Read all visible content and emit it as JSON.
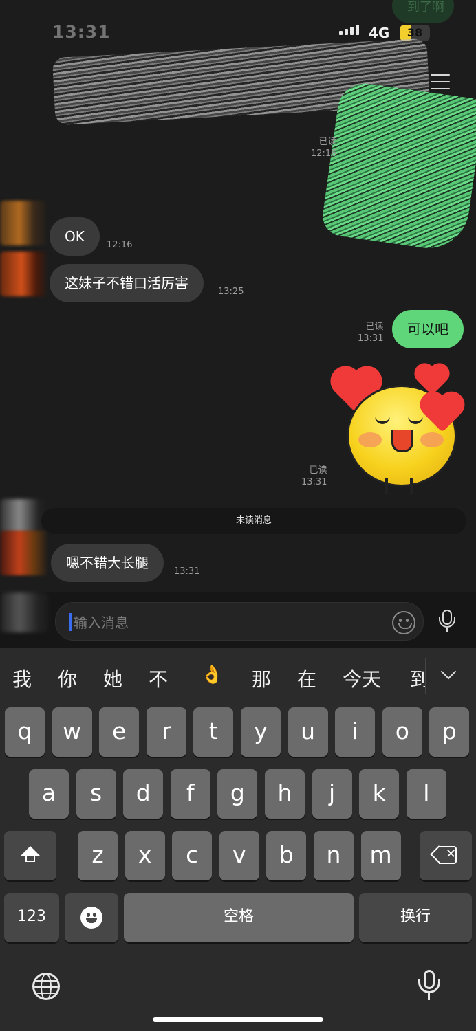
{
  "status_bar": {
    "time": "13:31",
    "network": "4G",
    "battery": "38",
    "battery_level": 0.38
  },
  "header": {
    "partial_bubble_text": "到了啊"
  },
  "messages": [
    {
      "id": "read-1",
      "read_label": "已读",
      "time": "12:16"
    },
    {
      "id": "in-1",
      "text": "OK",
      "time": "12:16"
    },
    {
      "id": "in-2",
      "text": "这妹子不错口活厉害",
      "time": "13:25"
    },
    {
      "id": "out-1",
      "text": "可以吧",
      "read_label": "已读",
      "time": "13:31"
    },
    {
      "id": "sticker",
      "read_label": "已读",
      "time": "13:31"
    },
    {
      "id": "in-3",
      "text": "嗯不错大长腿",
      "time": "13:31"
    }
  ],
  "unread_divider": "未读消息",
  "input": {
    "placeholder": "输入消息"
  },
  "keyboard": {
    "candidates": [
      "我",
      "你",
      "她",
      "不",
      "👌",
      "那",
      "在",
      "今天",
      "到"
    ],
    "row1": [
      "q",
      "w",
      "e",
      "r",
      "t",
      "y",
      "u",
      "i",
      "o",
      "p"
    ],
    "row2": [
      "a",
      "s",
      "d",
      "f",
      "g",
      "h",
      "j",
      "k",
      "l"
    ],
    "row3": [
      "z",
      "x",
      "c",
      "v",
      "b",
      "n",
      "m"
    ],
    "numbers_key": "123",
    "space_key": "空格",
    "return_key": "换行"
  }
}
